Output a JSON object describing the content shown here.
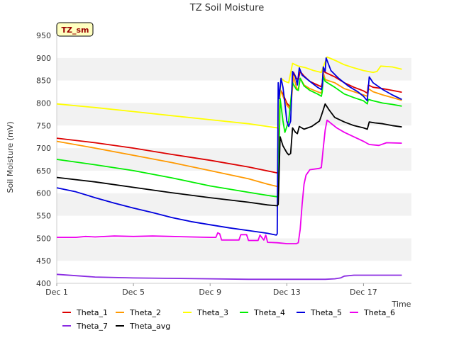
{
  "chart_data": {
    "type": "line",
    "title": "TZ Soil Moisture",
    "xlabel": "Time",
    "ylabel": "Soil Moisture (mV)",
    "badge": "TZ_sm",
    "ylim": [
      400,
      950
    ],
    "yticks": [
      400,
      450,
      500,
      550,
      600,
      650,
      700,
      750,
      800,
      850,
      900,
      950
    ],
    "xlim": [
      0,
      18.5
    ],
    "xticks": [
      {
        "label": "Dec 1",
        "x": 0
      },
      {
        "label": "Dec 5",
        "x": 4
      },
      {
        "label": "Dec 9",
        "x": 8
      },
      {
        "label": "Dec 13",
        "x": 12
      },
      {
        "label": "Dec 17",
        "x": 16
      }
    ],
    "grid": "horizontal bands",
    "legend": "bottom",
    "series": [
      {
        "name": "Theta_1",
        "color": "#dd0000",
        "points": [
          [
            0,
            722
          ],
          [
            2,
            712
          ],
          [
            4,
            700
          ],
          [
            6,
            686
          ],
          [
            8,
            673
          ],
          [
            10,
            658
          ],
          [
            11.5,
            645
          ],
          [
            11.55,
            650
          ],
          [
            11.65,
            830
          ],
          [
            11.8,
            820
          ],
          [
            12.0,
            800
          ],
          [
            12.2,
            790
          ],
          [
            12.35,
            868
          ],
          [
            12.5,
            855
          ],
          [
            12.6,
            852
          ],
          [
            12.7,
            870
          ],
          [
            12.9,
            860
          ],
          [
            13.2,
            848
          ],
          [
            13.6,
            840
          ],
          [
            13.8,
            836
          ],
          [
            13.85,
            845
          ],
          [
            13.9,
            872
          ],
          [
            14.0,
            868
          ],
          [
            14.5,
            858
          ],
          [
            15,
            845
          ],
          [
            15.5,
            835
          ],
          [
            16,
            827
          ],
          [
            16.2,
            822
          ],
          [
            16.25,
            840
          ],
          [
            16.5,
            835
          ],
          [
            17,
            832
          ],
          [
            17.5,
            828
          ],
          [
            18,
            824
          ]
        ]
      },
      {
        "name": "Theta_2",
        "color": "#ff9900",
        "points": [
          [
            0,
            715
          ],
          [
            2,
            700
          ],
          [
            4,
            684
          ],
          [
            6,
            668
          ],
          [
            8,
            650
          ],
          [
            10,
            632
          ],
          [
            11,
            620
          ],
          [
            11.5,
            615
          ],
          [
            11.55,
            618
          ],
          [
            11.65,
            830
          ],
          [
            11.8,
            815
          ],
          [
            12.0,
            795
          ],
          [
            12.2,
            785
          ],
          [
            12.35,
            860
          ],
          [
            12.5,
            835
          ],
          [
            12.6,
            828
          ],
          [
            12.7,
            855
          ],
          [
            12.9,
            840
          ],
          [
            13.2,
            832
          ],
          [
            13.6,
            825
          ],
          [
            13.8,
            822
          ],
          [
            13.85,
            835
          ],
          [
            13.9,
            868
          ],
          [
            14.0,
            852
          ],
          [
            14.5,
            845
          ],
          [
            15,
            832
          ],
          [
            15.5,
            825
          ],
          [
            16,
            818
          ],
          [
            16.2,
            815
          ],
          [
            16.25,
            832
          ],
          [
            16.5,
            825
          ],
          [
            17,
            818
          ],
          [
            17.5,
            812
          ],
          [
            18,
            806
          ]
        ]
      },
      {
        "name": "Theta_3",
        "color": "#ffff00",
        "points": [
          [
            0,
            798
          ],
          [
            2,
            790
          ],
          [
            4,
            781
          ],
          [
            6,
            772
          ],
          [
            8,
            763
          ],
          [
            10,
            754
          ],
          [
            11.5,
            745
          ],
          [
            11.55,
            745
          ],
          [
            11.7,
            855
          ],
          [
            11.9,
            848
          ],
          [
            12.1,
            845
          ],
          [
            12.3,
            888
          ],
          [
            12.6,
            882
          ],
          [
            13.0,
            878
          ],
          [
            13.4,
            872
          ],
          [
            13.8,
            868
          ],
          [
            13.9,
            880
          ],
          [
            14.1,
            902
          ],
          [
            14.5,
            895
          ],
          [
            15,
            885
          ],
          [
            15.5,
            878
          ],
          [
            16,
            872
          ],
          [
            16.5,
            868
          ],
          [
            16.7,
            870
          ],
          [
            16.9,
            882
          ],
          [
            17.5,
            880
          ],
          [
            18,
            875
          ]
        ]
      },
      {
        "name": "Theta_4",
        "color": "#00ee00",
        "points": [
          [
            0,
            675
          ],
          [
            2,
            663
          ],
          [
            4,
            650
          ],
          [
            6,
            634
          ],
          [
            8,
            616
          ],
          [
            10,
            602
          ],
          [
            11,
            595
          ],
          [
            11.5,
            592
          ],
          [
            11.55,
            600
          ],
          [
            11.65,
            810
          ],
          [
            11.8,
            760
          ],
          [
            11.9,
            735
          ],
          [
            12.1,
            760
          ],
          [
            12.3,
            845
          ],
          [
            12.5,
            830
          ],
          [
            12.6,
            828
          ],
          [
            12.7,
            855
          ],
          [
            12.9,
            838
          ],
          [
            13.2,
            828
          ],
          [
            13.6,
            820
          ],
          [
            13.8,
            815
          ],
          [
            13.85,
            825
          ],
          [
            13.9,
            858
          ],
          [
            14.0,
            848
          ],
          [
            14.5,
            835
          ],
          [
            15,
            820
          ],
          [
            15.5,
            812
          ],
          [
            16,
            805
          ],
          [
            16.2,
            798
          ],
          [
            16.25,
            808
          ],
          [
            16.5,
            805
          ],
          [
            17,
            800
          ],
          [
            17.5,
            797
          ],
          [
            18,
            793
          ]
        ]
      },
      {
        "name": "Theta_5",
        "color": "#0000dd",
        "points": [
          [
            0,
            612
          ],
          [
            1,
            603
          ],
          [
            2,
            590
          ],
          [
            3,
            578
          ],
          [
            4,
            567
          ],
          [
            5,
            557
          ],
          [
            6,
            546
          ],
          [
            7,
            537
          ],
          [
            8,
            530
          ],
          [
            9,
            523
          ],
          [
            10,
            517
          ],
          [
            11,
            511
          ],
          [
            11.45,
            507
          ],
          [
            11.5,
            510
          ],
          [
            11.55,
            845
          ],
          [
            11.6,
            810
          ],
          [
            11.7,
            855
          ],
          [
            11.8,
            835
          ],
          [
            11.9,
            800
          ],
          [
            12.0,
            760
          ],
          [
            12.1,
            748
          ],
          [
            12.2,
            760
          ],
          [
            12.3,
            870
          ],
          [
            12.45,
            858
          ],
          [
            12.55,
            840
          ],
          [
            12.65,
            878
          ],
          [
            12.8,
            862
          ],
          [
            13.2,
            848
          ],
          [
            13.6,
            835
          ],
          [
            13.8,
            830
          ],
          [
            13.85,
            838
          ],
          [
            13.9,
            880
          ],
          [
            14.0,
            870
          ],
          [
            14.05,
            900
          ],
          [
            14.3,
            872
          ],
          [
            14.7,
            855
          ],
          [
            15.2,
            838
          ],
          [
            15.7,
            825
          ],
          [
            16,
            815
          ],
          [
            16.2,
            805
          ],
          [
            16.3,
            858
          ],
          [
            16.5,
            845
          ],
          [
            17,
            830
          ],
          [
            17.5,
            818
          ],
          [
            18,
            808
          ]
        ]
      },
      {
        "name": "Theta_6",
        "color": "#ee00ee",
        "points": [
          [
            0,
            502
          ],
          [
            1,
            502
          ],
          [
            1.5,
            504
          ],
          [
            2,
            503
          ],
          [
            3,
            505
          ],
          [
            4,
            504
          ],
          [
            5,
            505
          ],
          [
            6,
            504
          ],
          [
            7,
            503
          ],
          [
            8,
            502
          ],
          [
            8.3,
            502
          ],
          [
            8.4,
            512
          ],
          [
            8.5,
            510
          ],
          [
            8.6,
            496
          ],
          [
            9.5,
            496
          ],
          [
            9.6,
            508
          ],
          [
            9.9,
            508
          ],
          [
            10.0,
            495
          ],
          [
            10.5,
            495
          ],
          [
            10.6,
            507
          ],
          [
            10.8,
            496
          ],
          [
            10.9,
            507
          ],
          [
            11,
            491
          ],
          [
            11.5,
            490
          ],
          [
            12,
            488
          ],
          [
            12.5,
            488
          ],
          [
            12.6,
            490
          ],
          [
            12.7,
            520
          ],
          [
            12.8,
            575
          ],
          [
            12.9,
            620
          ],
          [
            13.0,
            640
          ],
          [
            13.2,
            652
          ],
          [
            13.7,
            655
          ],
          [
            13.8,
            657
          ],
          [
            13.9,
            700
          ],
          [
            14.0,
            740
          ],
          [
            14.1,
            762
          ],
          [
            14.3,
            755
          ],
          [
            14.6,
            745
          ],
          [
            15,
            735
          ],
          [
            15.5,
            725
          ],
          [
            16,
            715
          ],
          [
            16.3,
            708
          ],
          [
            16.8,
            706
          ],
          [
            17.2,
            712
          ],
          [
            18,
            711
          ]
        ]
      },
      {
        "name": "Theta_7",
        "color": "#8a2be2",
        "points": [
          [
            0,
            420
          ],
          [
            1,
            417
          ],
          [
            2,
            414
          ],
          [
            4,
            412
          ],
          [
            6,
            411
          ],
          [
            8,
            410
          ],
          [
            10,
            409
          ],
          [
            12,
            409
          ],
          [
            14,
            409
          ],
          [
            14.5,
            410
          ],
          [
            14.8,
            412
          ],
          [
            15,
            416
          ],
          [
            15.5,
            418
          ],
          [
            16,
            418
          ],
          [
            17,
            418
          ],
          [
            18,
            418
          ]
        ]
      },
      {
        "name": "Theta_avg",
        "color": "#000000",
        "points": [
          [
            0,
            635
          ],
          [
            2,
            625
          ],
          [
            4,
            613
          ],
          [
            6,
            601
          ],
          [
            8,
            590
          ],
          [
            10,
            580
          ],
          [
            11,
            574
          ],
          [
            11.5,
            572
          ],
          [
            11.55,
            575
          ],
          [
            11.65,
            725
          ],
          [
            11.8,
            705
          ],
          [
            12.0,
            690
          ],
          [
            12.1,
            685
          ],
          [
            12.2,
            688
          ],
          [
            12.3,
            745
          ],
          [
            12.45,
            735
          ],
          [
            12.55,
            732
          ],
          [
            12.65,
            748
          ],
          [
            12.9,
            742
          ],
          [
            13.3,
            748
          ],
          [
            13.7,
            760
          ],
          [
            13.8,
            772
          ],
          [
            13.9,
            785
          ],
          [
            14.0,
            798
          ],
          [
            14.2,
            785
          ],
          [
            14.5,
            768
          ],
          [
            15,
            758
          ],
          [
            15.5,
            750
          ],
          [
            16,
            745
          ],
          [
            16.2,
            742
          ],
          [
            16.3,
            758
          ],
          [
            16.6,
            756
          ],
          [
            17,
            754
          ],
          [
            17.5,
            750
          ],
          [
            18,
            747
          ]
        ]
      }
    ]
  }
}
